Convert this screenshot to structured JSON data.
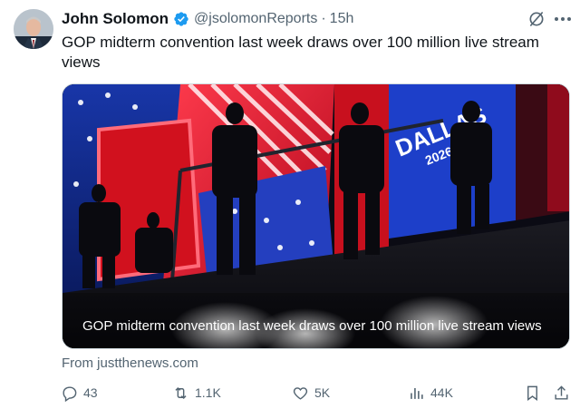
{
  "author": {
    "name": "John Solomon",
    "handle": "@jsolomonReports",
    "separator": "·",
    "time": "15h",
    "verified": true
  },
  "tweet": {
    "text": "GOP midterm convention last week draws over 100 million live stream views"
  },
  "media": {
    "caption": "GOP midterm convention last week draws over 100 million live stream views",
    "sign_text": "DALLAS",
    "sign_year": "2026"
  },
  "source": "From justthenews.com",
  "actions": {
    "replies": "43",
    "reposts": "1.1K",
    "likes": "5K",
    "views": "44K"
  },
  "colors": {
    "verified_blue": "#1d9bf0",
    "secondary_text": "#536471",
    "primary_text": "#0f1419"
  },
  "icons": [
    "verified-badge-icon",
    "grok-icon",
    "more-icon",
    "reply-icon",
    "retweet-icon",
    "like-icon",
    "views-icon",
    "bookmark-icon",
    "share-icon"
  ]
}
